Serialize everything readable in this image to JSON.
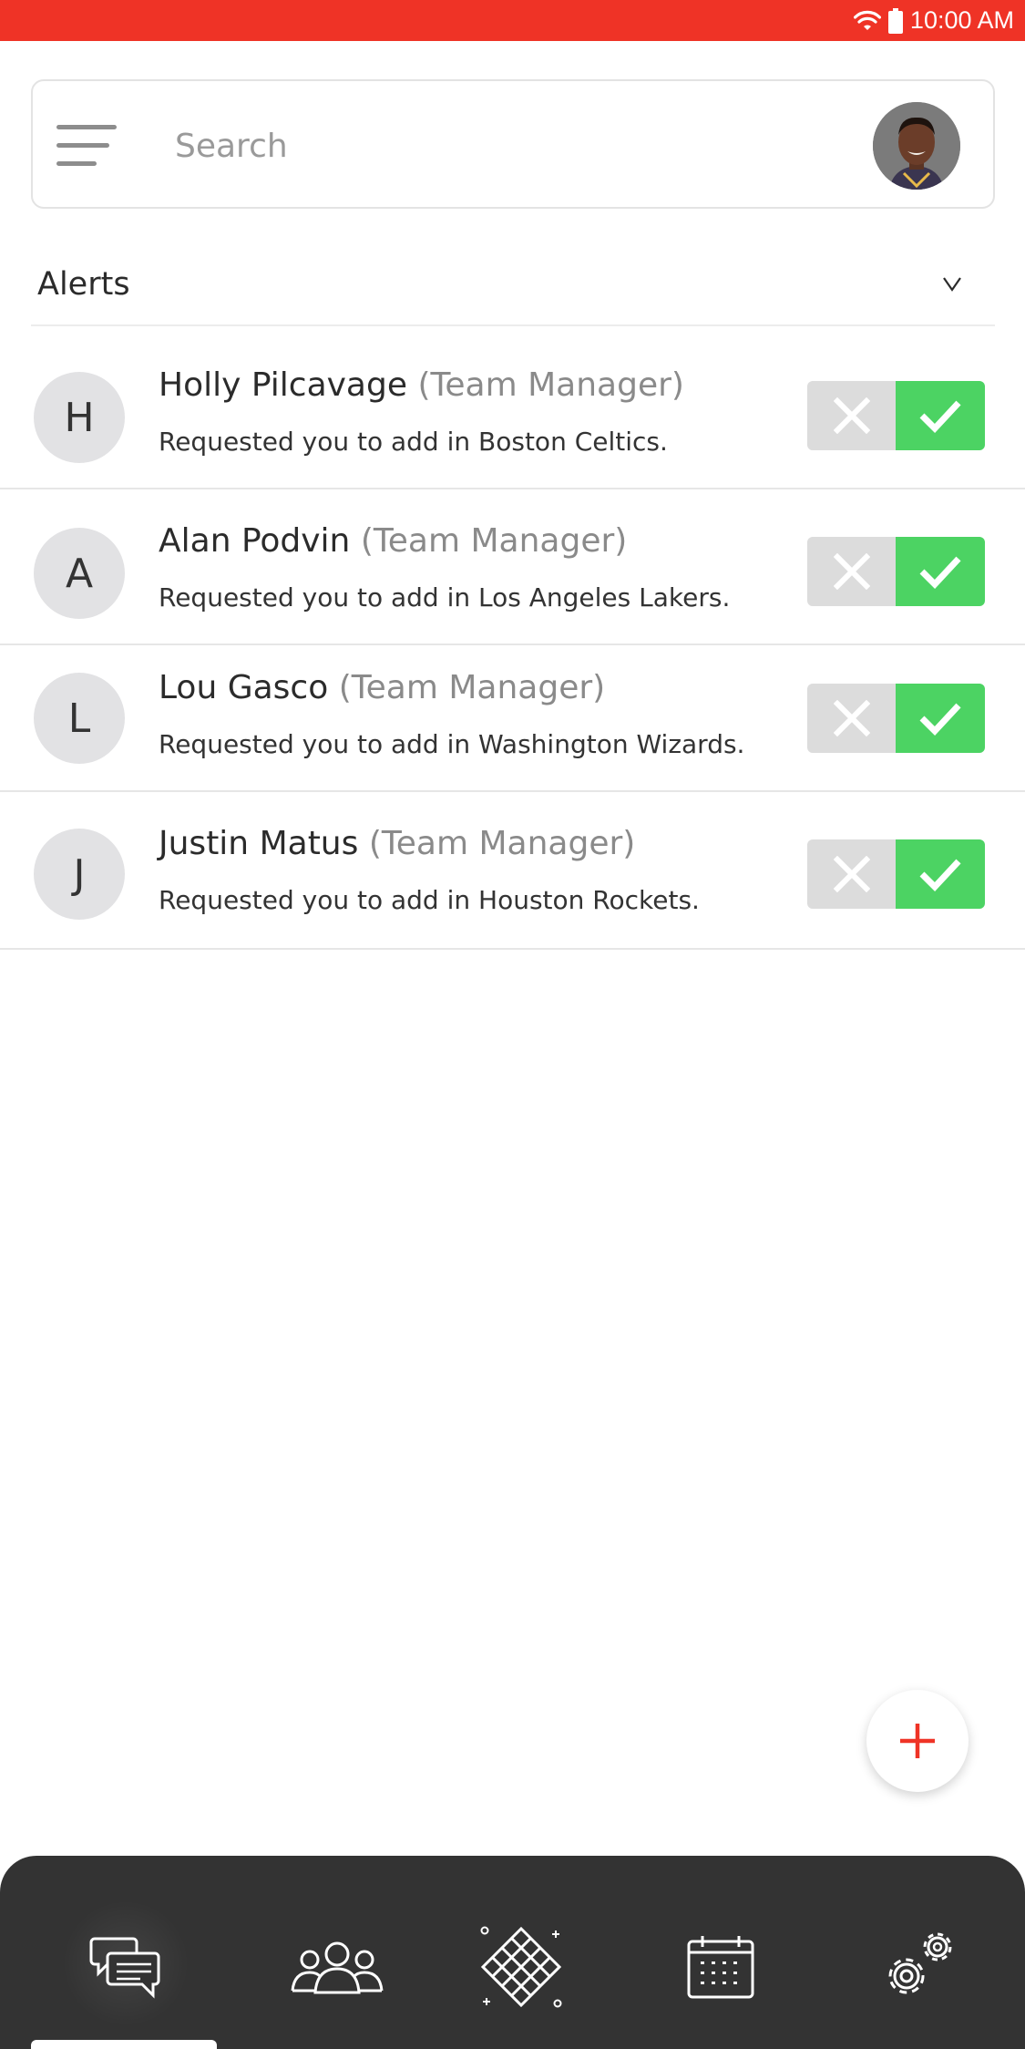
{
  "status_bar": {
    "time": "10:00 AM"
  },
  "search": {
    "placeholder": "Search"
  },
  "alerts": {
    "title": "Alerts",
    "items": [
      {
        "initial": "H",
        "name": "Holly Pilcavage",
        "role": "(Team Manager)",
        "message": "Requested you to add in Boston Celtics."
      },
      {
        "initial": "A",
        "name": "Alan Podvin",
        "role": "(Team Manager)",
        "message": "Requested you to add in Los Angeles Lakers."
      },
      {
        "initial": "L",
        "name": "Lou Gasco",
        "role": "(Team Manager)",
        "message": "Requested you to add in Washington Wizards."
      },
      {
        "initial": "J",
        "name": "Justin Matus",
        "role": "(Team Manager)",
        "message": "Requested you to add in Houston Rockets."
      }
    ]
  },
  "colors": {
    "brand_red": "#ef3326",
    "accept_green": "#4cd363",
    "reject_gray": "#dcdcdc",
    "nav_bg": "#333333"
  },
  "nav": {
    "items": [
      "chat-icon",
      "team-icon",
      "court-icon",
      "calendar-icon",
      "settings-icon"
    ],
    "active": "chat-icon"
  }
}
